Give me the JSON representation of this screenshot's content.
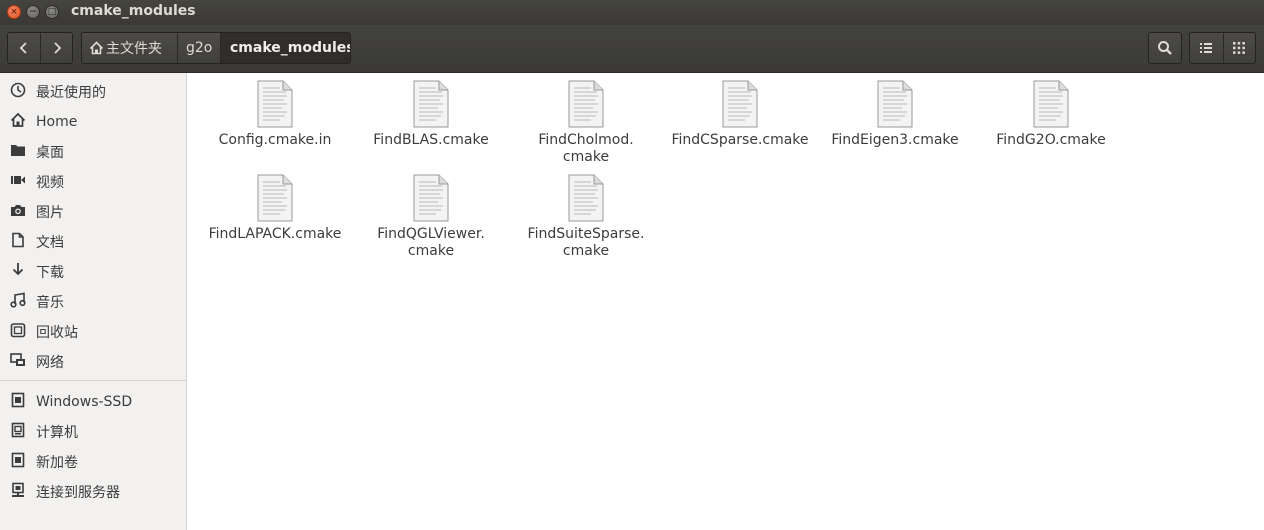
{
  "window": {
    "title": "cmake_modules",
    "close_glyph": "×",
    "min_glyph": "−",
    "max_glyph": "□"
  },
  "toolbar": {
    "back_icon": "chevron-left-icon",
    "forward_icon": "chevron-right-icon",
    "breadcrumbs": [
      {
        "label": "主文件夹",
        "icon": "home-icon"
      },
      {
        "label": "g2o"
      },
      {
        "label": "cmake_modules",
        "active": true
      }
    ],
    "search_icon": "search-icon",
    "list_view_icon": "list-view-icon",
    "grid_view_icon": "grid-view-icon"
  },
  "sidebar": {
    "items": [
      {
        "label": "最近使用的",
        "icon": "recent-icon"
      },
      {
        "label": "Home",
        "icon": "home-icon"
      },
      {
        "label": "桌面",
        "icon": "desktop-icon"
      },
      {
        "label": "视频",
        "icon": "video-icon"
      },
      {
        "label": "图片",
        "icon": "camera-icon"
      },
      {
        "label": "文档",
        "icon": "document-icon"
      },
      {
        "label": "下载",
        "icon": "download-icon"
      },
      {
        "label": "音乐",
        "icon": "music-icon"
      },
      {
        "label": "回收站",
        "icon": "trash-icon"
      },
      {
        "label": "网络",
        "icon": "network-icon"
      }
    ],
    "devices": [
      {
        "label": "Windows-SSD",
        "icon": "drive-icon"
      },
      {
        "label": "计算机",
        "icon": "computer-icon"
      },
      {
        "label": "新加卷",
        "icon": "drive-icon"
      },
      {
        "label": "连接到服务器",
        "icon": "server-icon"
      }
    ]
  },
  "files": [
    {
      "line1": "Config.cmake.in",
      "line2": ""
    },
    {
      "line1": "FindBLAS.cmake",
      "line2": ""
    },
    {
      "line1": "FindCholmod.",
      "line2": "cmake"
    },
    {
      "line1": "FindCSparse.cmake",
      "line2": ""
    },
    {
      "line1": "FindEigen3.cmake",
      "line2": ""
    },
    {
      "line1": "FindG2O.cmake",
      "line2": ""
    },
    {
      "line1": "FindLAPACK.cmake",
      "line2": ""
    },
    {
      "line1": "FindQGLViewer.",
      "line2": "cmake"
    },
    {
      "line1": "FindSuiteSparse.",
      "line2": "cmake"
    }
  ]
}
